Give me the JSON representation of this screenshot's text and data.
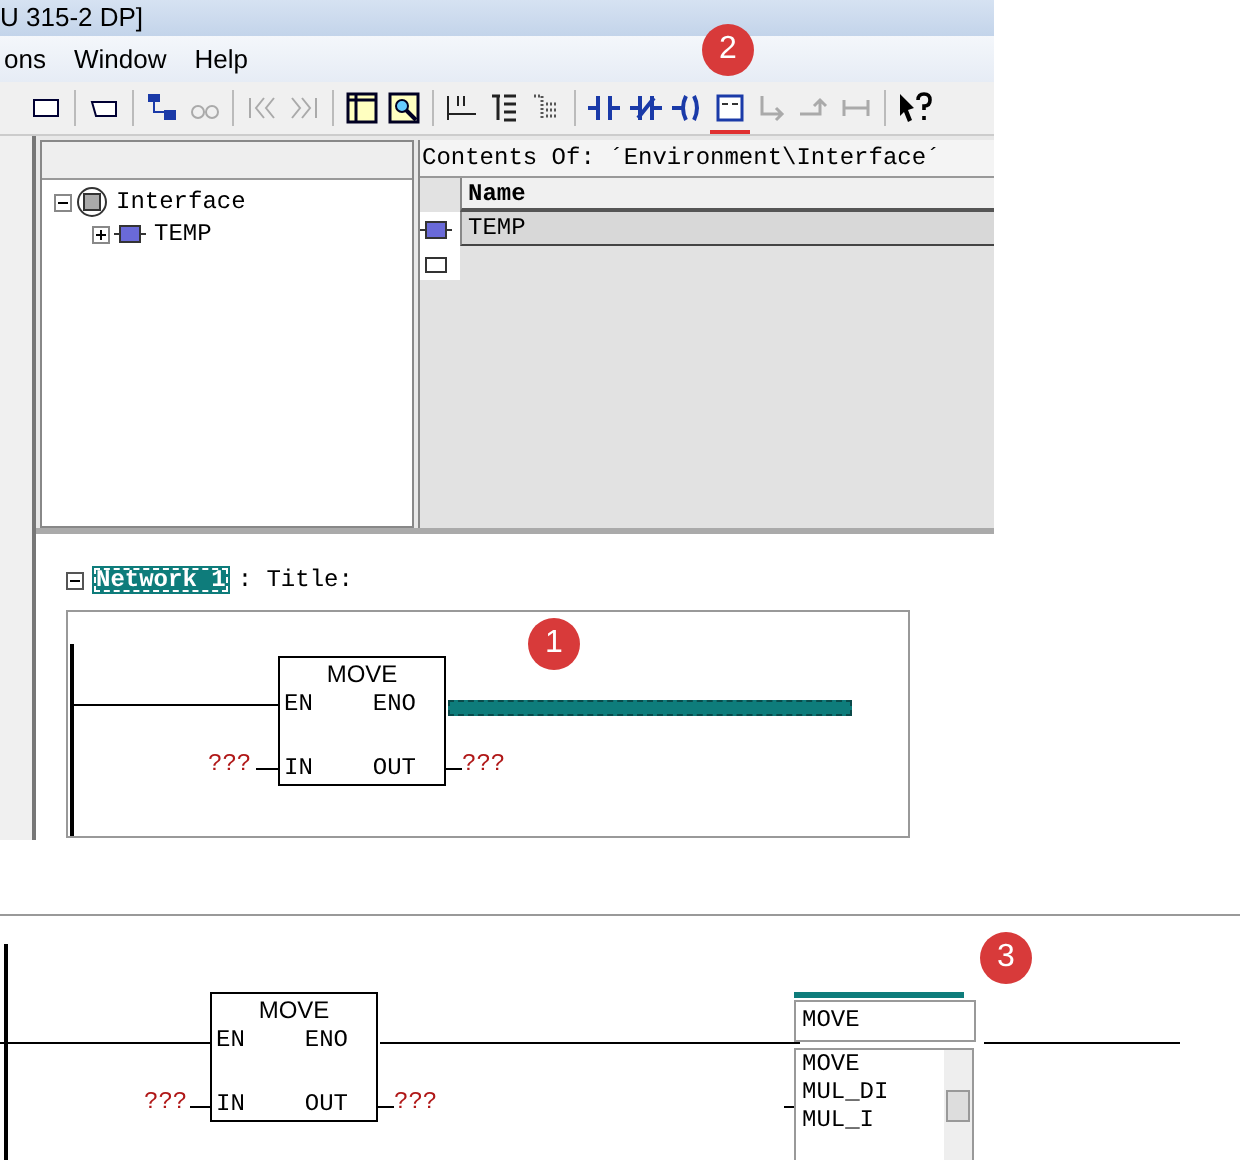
{
  "window": {
    "title": "U 315-2 DP]"
  },
  "menu": [
    "ons",
    "Window",
    "Help"
  ],
  "toolbar": {
    "badge": "2"
  },
  "tree": [
    {
      "label": "Interface",
      "expanded": true,
      "children": [
        {
          "label": "TEMP",
          "expanded": false
        }
      ]
    }
  ],
  "contents": {
    "header": "Contents Of: ´Environment\\Interface´",
    "column": "Name",
    "rows": [
      {
        "name": "TEMP",
        "selected": true
      }
    ]
  },
  "network": {
    "expanded": true,
    "label": "Network 1",
    "title": ": Title:",
    "badge": "1",
    "block": {
      "name": "MOVE",
      "pins": [
        "EN",
        "ENO",
        "IN",
        "OUT"
      ],
      "in": "???",
      "out": "???"
    }
  },
  "network_2": {
    "badge": "3",
    "block": {
      "name": "MOVE",
      "pins": [
        "EN",
        "ENO",
        "IN",
        "OUT"
      ],
      "in": "???",
      "out": "???"
    },
    "editor": {
      "value": "MOVE",
      "options": [
        "MOVE",
        "MUL_DI",
        "MUL_I"
      ]
    }
  }
}
